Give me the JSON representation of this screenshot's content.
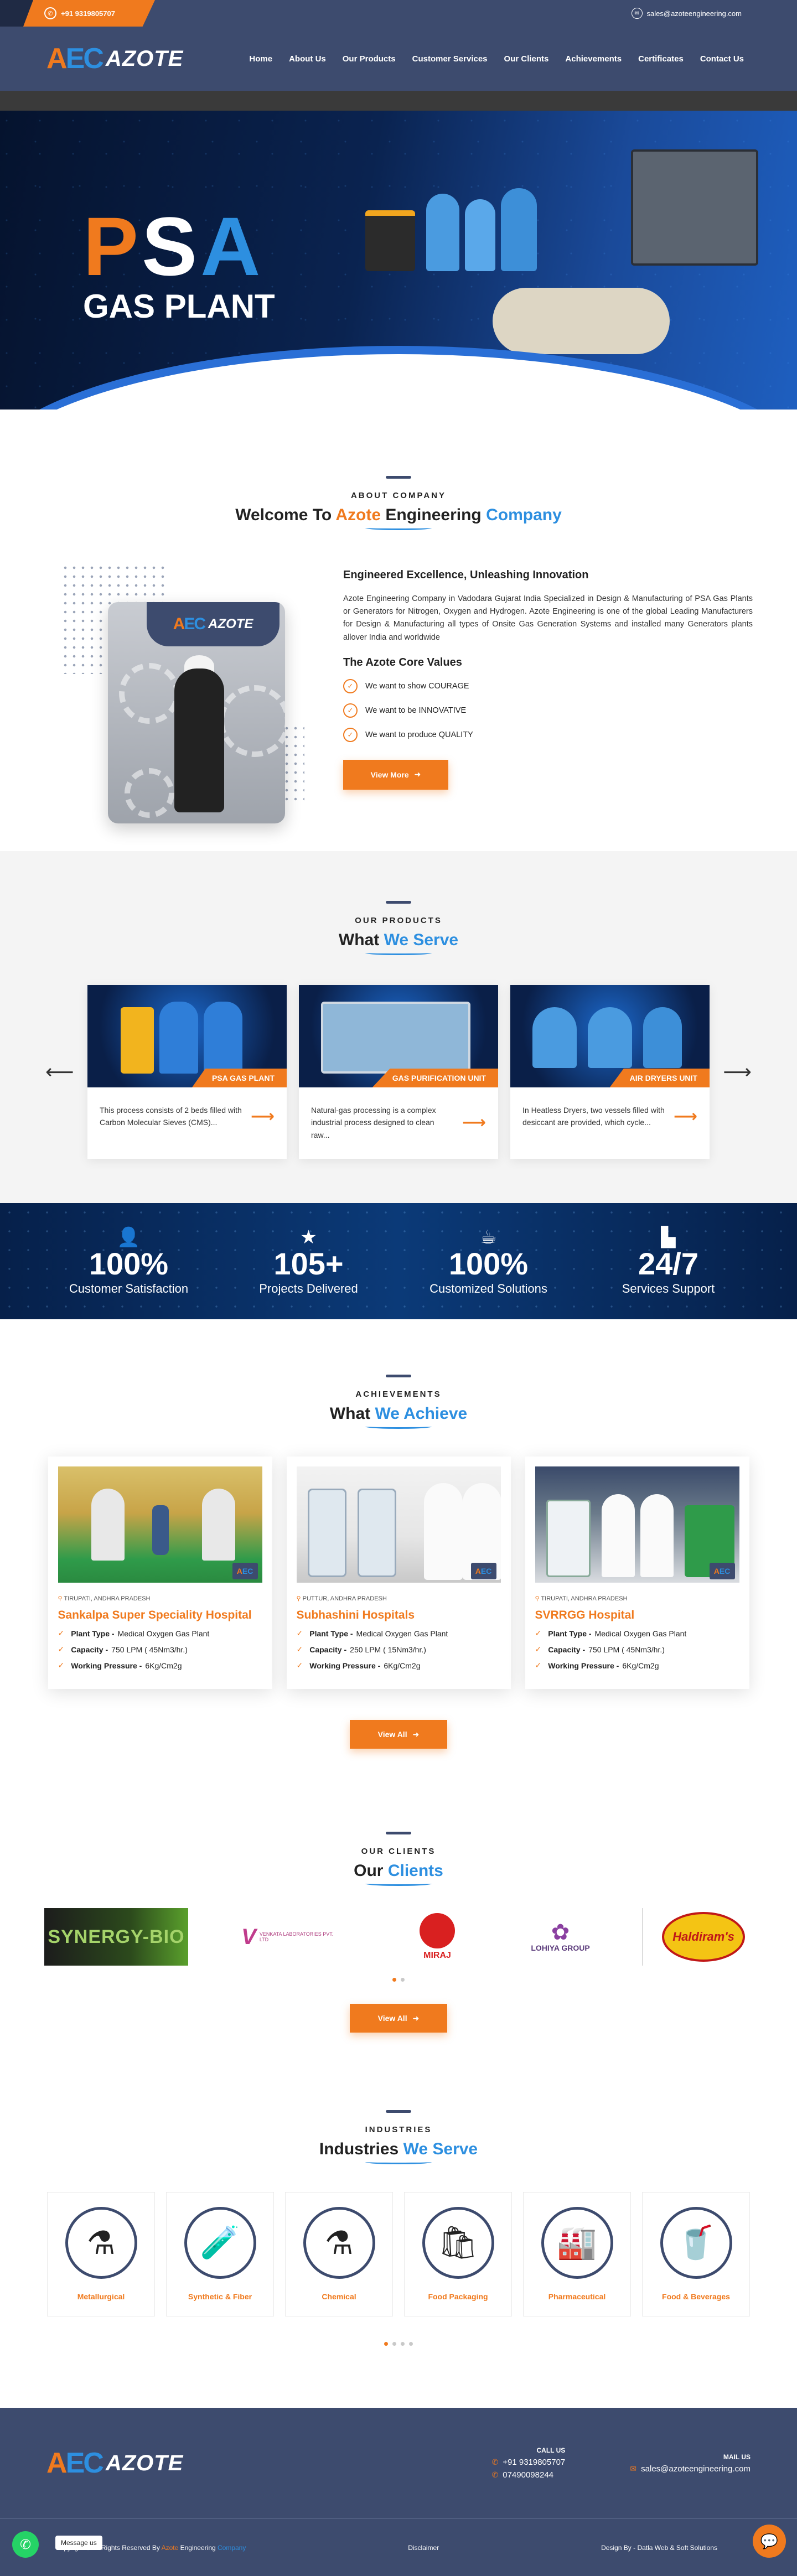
{
  "topbar": {
    "phone": "+91 9319805707",
    "email": "sales@azoteengineering.com"
  },
  "brand": {
    "logo_mark": "AEC",
    "name": "AZOTE"
  },
  "nav": [
    "Home",
    "About Us",
    "Our Products",
    "Customer Services",
    "Our Clients",
    "Achievements",
    "Certificates",
    "Contact Us"
  ],
  "hero": {
    "title_p": "P",
    "title_s": "S",
    "title_a": "A",
    "subtitle": "GAS PLANT"
  },
  "about": {
    "eyebrow": "ABOUT COMPANY",
    "title_1": "Welcome To ",
    "title_2": "Azote",
    "title_3": " Engineering ",
    "title_4": "Company",
    "heading": "Engineered Excellence, Unleashing Innovation",
    "text": "Azote Engineering Company in Vadodara Gujarat India Specialized in Design & Manufacturing of PSA Gas Plants or Generators for Nitrogen, Oxygen and Hydrogen. Azote Engineering is one of the global Leading Manufacturers for Design & Manufacturing all types of Onsite Gas Generation Systems and installed many Generators plants allover India and worldwide",
    "values_title": "The Azote Core Values",
    "values": [
      "We want to show COURAGE",
      "We want to be INNOVATIVE",
      "We want to produce QUALITY"
    ],
    "button": "View More",
    "card_logo": "AZOTE"
  },
  "products": {
    "eyebrow": "OUR PRODUCTS",
    "title_1": "What ",
    "title_2": "We Serve",
    "items": [
      {
        "tag": "PSA GAS PLANT",
        "text": "This process consists of 2 beds filled with Carbon Molecular Sieves (CMS)..."
      },
      {
        "tag": "GAS PURIFICATION UNIT",
        "text": "Natural-gas processing is a complex industrial process designed to clean raw..."
      },
      {
        "tag": "AIR DRYERS UNIT",
        "text": "In Heatless Dryers, two vessels filled with desiccant are provided, which cycle..."
      }
    ]
  },
  "stats": [
    {
      "icon": "user-icon",
      "num": "100%",
      "label": "Customer Satisfaction"
    },
    {
      "icon": "star-icon",
      "num": "105+",
      "label": "Projects Delivered"
    },
    {
      "icon": "cup-icon",
      "num": "100%",
      "label": "Customized Solutions"
    },
    {
      "icon": "chart-icon",
      "num": "24/7",
      "label": "Services Support"
    }
  ],
  "achievements": {
    "eyebrow": "ACHIEVEMENTS",
    "title_1": "What ",
    "title_2": "We Achieve",
    "items": [
      {
        "location": "TIRUPATI, ANDHRA PRADESH",
        "title": "Sankalpa Super Speciality Hospital",
        "plant_type": "Medical Oxygen Gas Plant",
        "capacity": "750 LPM ( 45Nm3/hr.)",
        "pressure": "6Kg/Cm2g"
      },
      {
        "location": "PUTTUR, ANDHRA PRADESH",
        "title": "Subhashini Hospitals",
        "plant_type": "Medical Oxygen Gas Plant",
        "capacity": "250 LPM ( 15Nm3/hr.)",
        "pressure": "6Kg/Cm2g"
      },
      {
        "location": "TIRUPATI, ANDHRA PRADESH",
        "title": "SVRRGG Hospital",
        "plant_type": "Medical Oxygen Gas Plant",
        "capacity": "750 LPM ( 45Nm3/hr.)",
        "pressure": "6Kg/Cm2g"
      }
    ],
    "labels": {
      "plant_type": "Plant Type -",
      "capacity": "Capacity -",
      "pressure": "Working Pressure -"
    },
    "button": "View All"
  },
  "clients": {
    "eyebrow": "OUR CLIENTS",
    "title_1": "Our ",
    "title_2": "Clients",
    "logos": [
      "SYNERGY-BIO",
      "VENKATA LABORATORIES PVT. LTD",
      "MIRAJ",
      "LOHIYA GROUP",
      "Haldiram's"
    ],
    "button": "View All"
  },
  "industries": {
    "eyebrow": "INDUSTRIES",
    "title_1": "Industries ",
    "title_2": "We Serve",
    "items": [
      {
        "label": "Metallurgical",
        "icon": "⚗"
      },
      {
        "label": "Synthetic & Fiber",
        "icon": "🧪"
      },
      {
        "label": "Chemical",
        "icon": "⚗"
      },
      {
        "label": "Food Packaging",
        "icon": "🛍"
      },
      {
        "label": "Pharmaceutical",
        "icon": "🏭"
      },
      {
        "label": "Food & Beverages",
        "icon": "🥤"
      }
    ]
  },
  "footer": {
    "call_head": "CALL US",
    "phone1": "+91 9319805707",
    "phone2": "07490098244",
    "mail_head": "MAIL US",
    "email": "sales@azoteengineering.com",
    "copyright_1": "Copyright © All Rights Reserved By ",
    "copyright_2": "Azote",
    "copyright_3": " Engineering ",
    "copyright_4": "Company",
    "disclaimer": "Disclaimer",
    "design": "Design By - Datla Web & Soft Solutions",
    "wa_msg": "Message us"
  }
}
